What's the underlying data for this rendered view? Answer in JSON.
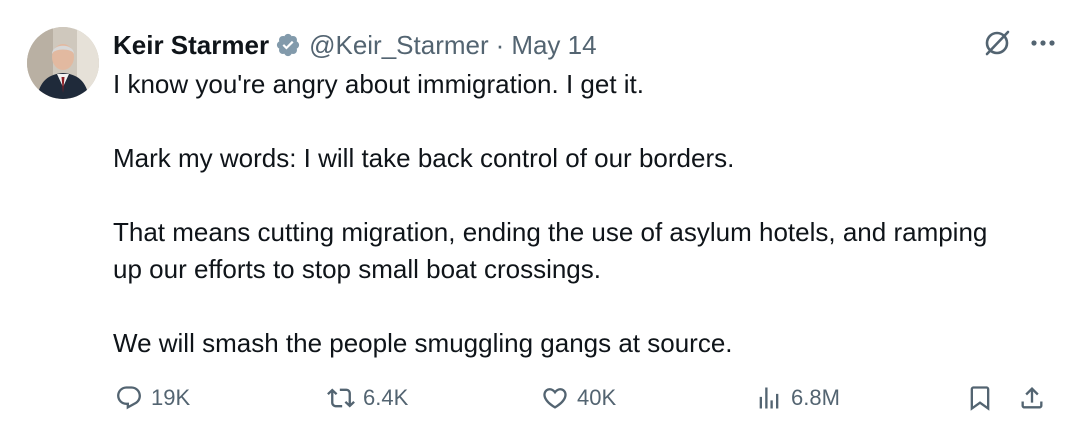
{
  "author": {
    "name": "Keir Starmer",
    "handle": "@Keir_Starmer",
    "separator": "·",
    "date": "May 14"
  },
  "post": {
    "paragraphs": [
      "I know you're angry about immigration. I get it.",
      "Mark my words: I will take back control of our borders.",
      "That means cutting migration, ending the use of asylum hotels, and ramping up our efforts to stop small boat crossings.",
      "We will smash the people smuggling gangs at source."
    ]
  },
  "actions": {
    "replies": "19K",
    "reposts": "6.4K",
    "likes": "40K",
    "views": "6.8M"
  },
  "icons": {
    "verified": "verified-badge-icon",
    "grok": "grok-icon",
    "more": "more-icon",
    "reply": "reply-icon",
    "repost": "repost-icon",
    "like": "heart-icon",
    "views": "views-icon",
    "bookmark": "bookmark-icon",
    "share": "share-icon"
  },
  "colors": {
    "text": "#0f1419",
    "secondary": "#536471",
    "verified": "#829aab"
  }
}
